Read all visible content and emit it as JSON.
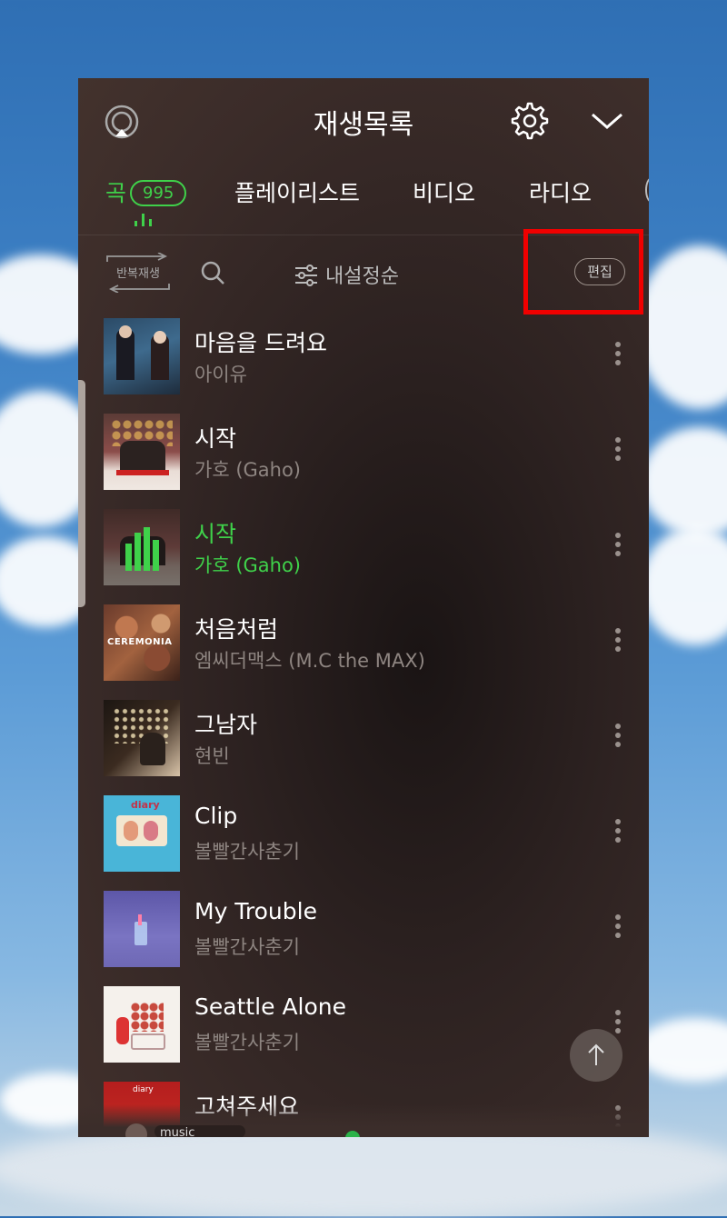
{
  "header": {
    "title": "재생목록",
    "icons": [
      "cast-icon",
      "gear-icon",
      "chevron-down-icon"
    ]
  },
  "tabs": {
    "songs": {
      "label": "곡",
      "count": "995"
    },
    "playlists": "플레이리스트",
    "videos": "비디오",
    "radio": "라디오"
  },
  "toolbar": {
    "repeat_label": "반복재생",
    "sort_label": "내설정순",
    "edit_label": "편집"
  },
  "colors": {
    "accent": "#3fd14a",
    "highlight": "#f00000",
    "panel": "#3b2c29"
  },
  "songs": [
    {
      "title": "마음을 드려요",
      "artist": "아이유",
      "playing": false
    },
    {
      "title": "시작",
      "artist": "가호 (Gaho)",
      "playing": false
    },
    {
      "title": "시작",
      "artist": "가호 (Gaho)",
      "playing": true
    },
    {
      "title": "처음처럼",
      "artist": "엠씨더맥스 (M.C the MAX)",
      "playing": false
    },
    {
      "title": "그남자",
      "artist": "현빈",
      "playing": false
    },
    {
      "title": "Clip",
      "artist": "볼빨간사춘기",
      "playing": false
    },
    {
      "title": "My Trouble",
      "artist": "볼빨간사춘기",
      "playing": false
    },
    {
      "title": "Seattle Alone",
      "artist": "볼빨간사춘기",
      "playing": false
    },
    {
      "title": "고쳐주세요",
      "artist": "",
      "playing": false
    }
  ],
  "art_text": {
    "ceremonia": "CEREMONIA",
    "diary": "diary"
  },
  "footer": {
    "mini_label": "music"
  }
}
